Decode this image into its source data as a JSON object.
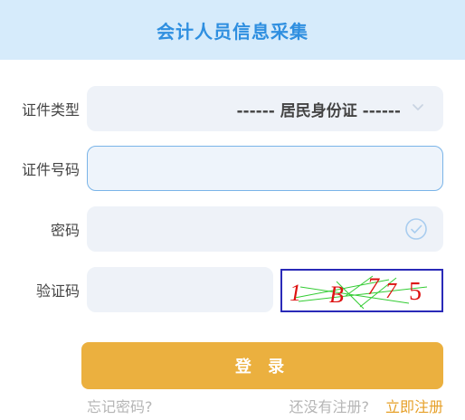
{
  "header": {
    "title": "会计人员信息采集"
  },
  "form": {
    "id_type": {
      "label": "证件类型",
      "value": "------ 居民身份证 ------"
    },
    "id_number": {
      "label": "证件号码",
      "value": ""
    },
    "password": {
      "label": "密码",
      "value": ""
    },
    "captcha": {
      "label": "验证码",
      "value": "",
      "image_text": [
        "1",
        "B",
        "7",
        "7",
        "5"
      ]
    }
  },
  "actions": {
    "login_label": "登 录",
    "forgot_password": "忘记密码?",
    "no_account": "还没有注册?",
    "register_now": "立即注册"
  },
  "colors": {
    "header_bg": "#d6ebfb",
    "title": "#2f8fe0",
    "input_bg": "#eef2f8",
    "focus_border": "#7ab4e8",
    "login_button": "#ebb03f",
    "register_link": "#e6a028",
    "muted_text": "#b5b5b5"
  },
  "icons": {
    "select_chevron": "chevron-down-icon",
    "password_check": "check-circle-icon"
  }
}
